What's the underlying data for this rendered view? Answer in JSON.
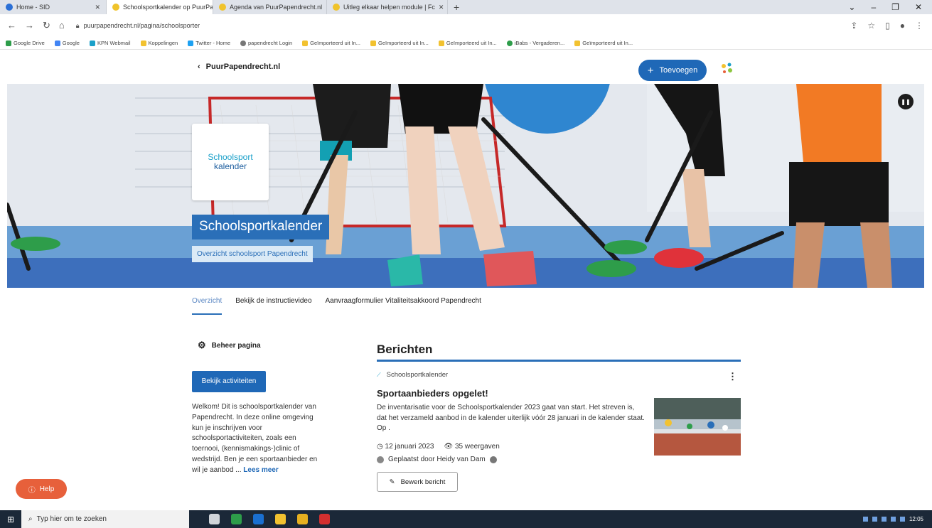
{
  "browser": {
    "tabs": [
      {
        "label": "Home - SID",
        "active": false,
        "color": "#2a6fd6"
      },
      {
        "label": "Schoolsportkalender op PuurPa",
        "active": true,
        "color": "#f0c32b"
      },
      {
        "label": "Agenda van PuurPapendrecht.nl",
        "active": false,
        "color": "#f0c32b"
      },
      {
        "label": "Uitleg elkaar helpen module | Fc",
        "active": false,
        "color": "#f0c32b"
      }
    ],
    "url": "puurpapendrecht.nl/pagina/schoolsporter",
    "bookmarks": [
      {
        "label": "Google Drive",
        "color": "#2e9d4a"
      },
      {
        "label": "Google",
        "color": "#4285f4"
      },
      {
        "label": "KPN Webmail",
        "color": "#1aa0c9"
      },
      {
        "label": "Koppelingen",
        "color": "#f2c230"
      },
      {
        "label": "Twitter - Home",
        "color": "#1da1f2"
      },
      {
        "label": "papendrecht Login",
        "color": "#777777"
      },
      {
        "label": "Geïmporteerd uit In...",
        "color": "#f2c230"
      },
      {
        "label": "Geïmporteerd uit In...",
        "color": "#f2c230"
      },
      {
        "label": "Geïmporteerd uit In...",
        "color": "#f2c230"
      },
      {
        "label": "iBabs - Vergaderen...",
        "color": "#2e9d4a"
      },
      {
        "label": "Geïmporteerd uit In...",
        "color": "#f2c230"
      }
    ]
  },
  "site": {
    "back_label": "PuurPapendrecht.nl",
    "add_label": "Toevoegen",
    "logo_line1": "Schoolsport",
    "logo_line2": "kalender",
    "hero_title": "Schoolsportkalender",
    "hero_subtitle": "Overzicht schoolsport Papendrecht",
    "tabs": [
      "Overzicht",
      "Bekijk de instructievideo",
      "Aanvraagformulier Vitaliteitsakkoord Papendrecht"
    ],
    "manage_label": "Beheer pagina",
    "activities_button": "Bekijk activiteiten",
    "welcome_text": "Welkom! Dit is schoolsportkalender van Papendrecht. In deze online omgeving kun je inschrijven voor schoolsportactiviteiten, zoals een toernooi, (kennismakings-)clinic of wedstrijd. Ben je een sportaanbieder en wil je aanbod ...",
    "read_more": "Lees meer",
    "posts_heading": "Berichten",
    "post": {
      "author": "Schoolsportkalender",
      "title": "Sportaanbieders opgelet!",
      "text": "De inventarisatie voor de Schoolsportkalender 2023 gaat van start. Het streven is, dat het verzameld aanbod in de kalender uiterlijk vóór 28 januari in de kalender staat. Op .",
      "date": "12 januari 2023",
      "views": "35 weergaven",
      "placed_by": "Geplaatst door Heidy van Dam",
      "edit_label": "Bewerk bericht"
    },
    "help_label": "Help"
  },
  "taskbar": {
    "search_placeholder": "Typ hier om te zoeken",
    "time": "12:05"
  },
  "colors": {
    "brand_blue": "#2a6fb8",
    "help_orange": "#e7603b"
  }
}
